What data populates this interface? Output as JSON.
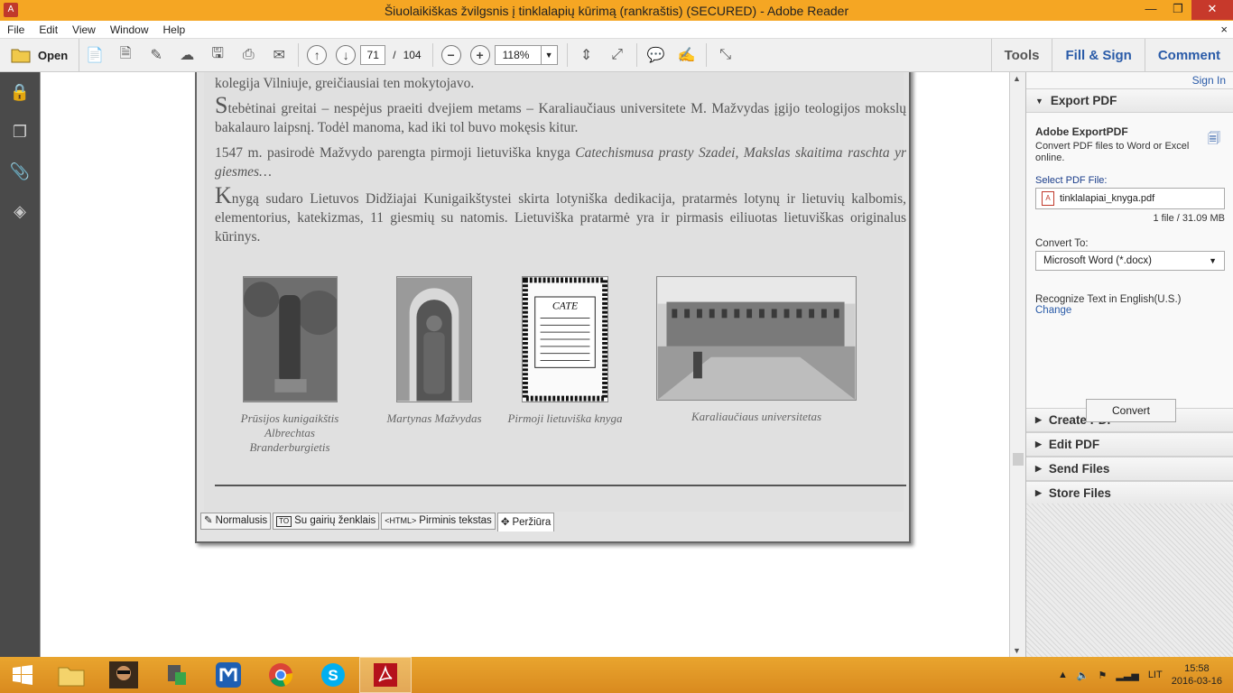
{
  "window": {
    "title": "Šiuolaikiškas žvilgsnis į tinklalapių kūrimą (rankraštis) (SECURED) - Adobe Reader",
    "minimize": "—",
    "restore": "❐",
    "close": "✕"
  },
  "menu": {
    "items": [
      "File",
      "Edit",
      "View",
      "Window",
      "Help"
    ],
    "close_doc": "×"
  },
  "toolbar": {
    "open_label": "Open",
    "page_current": "71",
    "page_sep": "/",
    "page_total": "104",
    "zoom": "118%",
    "tools": "Tools",
    "fill_sign": "Fill & Sign",
    "comment": "Comment"
  },
  "document": {
    "para1": "kolegija Vilniuje, greičiausiai ten mokytojavo.",
    "para2_cap": "S",
    "para2": "tebėtinai greitai – nespėjus praeiti dvejiem metams – Karaliaučiaus universitete M. Mažvydas įgijo teologijos mokslų bakalauro laipsnį. Todėl manoma, kad iki tol buvo mokęsis kitur.",
    "para3_start": "1547 m. pasirodė Mažvydo parengta pirmoji lietuviška knyga ",
    "para3_italic": "Catechismusa prasty Szadei, Makslas skaitima raschta yr giesmes…",
    "para4_cap": "K",
    "para4": "nygą sudaro Lietuvos Didžiajai Kunigaikštystei skirta lotyniška dedikacija, pratarmės lotynų ir lietuvių kalbomis, elementorius, katekizmas, 11 giesmių su natomis. Lietuviška pratarmė yra ir pirmasis eiliuotas lietuviškas originalus kūrinys.",
    "captions": [
      "Prūsijos kunigaikštis Albrechtas Branderburgietis",
      "Martynas Mažvydas",
      "Pirmoji lietuviška knyga",
      "Karaliaučiaus universitetas"
    ],
    "book_title": "CATE",
    "tabs": [
      "Normalusis",
      "Su gairių ženklais",
      "Pirminis tekstas",
      "Peržiūra"
    ],
    "tab_badges": [
      "TO",
      "<HTML>"
    ]
  },
  "panel": {
    "sign_in": "Sign In",
    "export_pdf": "Export PDF",
    "adobe_export": "Adobe ExportPDF",
    "export_desc": "Convert PDF files to Word or Excel online.",
    "select_label": "Select PDF File:",
    "file_name": "tinklalapiai_knyga.pdf",
    "file_meta": "1 file / 31.09 MB",
    "convert_to_label": "Convert To:",
    "convert_to_value": "Microsoft Word (*.docx)",
    "recognize": "Recognize Text in English(U.S.)",
    "change": "Change",
    "convert_button": "Convert",
    "sections": [
      "Create PDF",
      "Edit PDF",
      "Send Files",
      "Store Files"
    ]
  },
  "taskbar": {
    "lang": "LIT",
    "time": "15:58",
    "date": "2016-03-16"
  }
}
